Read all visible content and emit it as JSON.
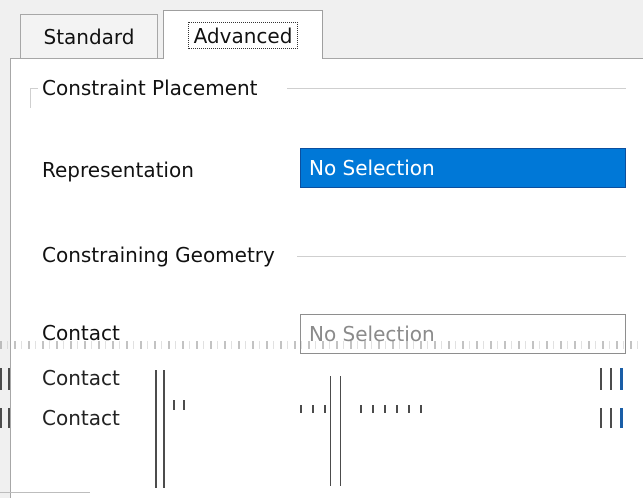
{
  "tabs": [
    {
      "label": "Standard"
    },
    {
      "label": "Advanced"
    }
  ],
  "constraint_placement": {
    "group_title": "Constraint Placement",
    "representation_label": "Representation",
    "representation_value": "No Selection"
  },
  "constraining_geometry": {
    "group_title": "Constraining Geometry",
    "rows": [
      {
        "label": "Contact",
        "value": "No Selection"
      },
      {
        "label": "Contact"
      },
      {
        "label": "Contact"
      }
    ]
  },
  "colors": {
    "selection_blue": "#0078d7",
    "panel_border": "#a7a7a7",
    "group_line": "#cfcfcf"
  }
}
